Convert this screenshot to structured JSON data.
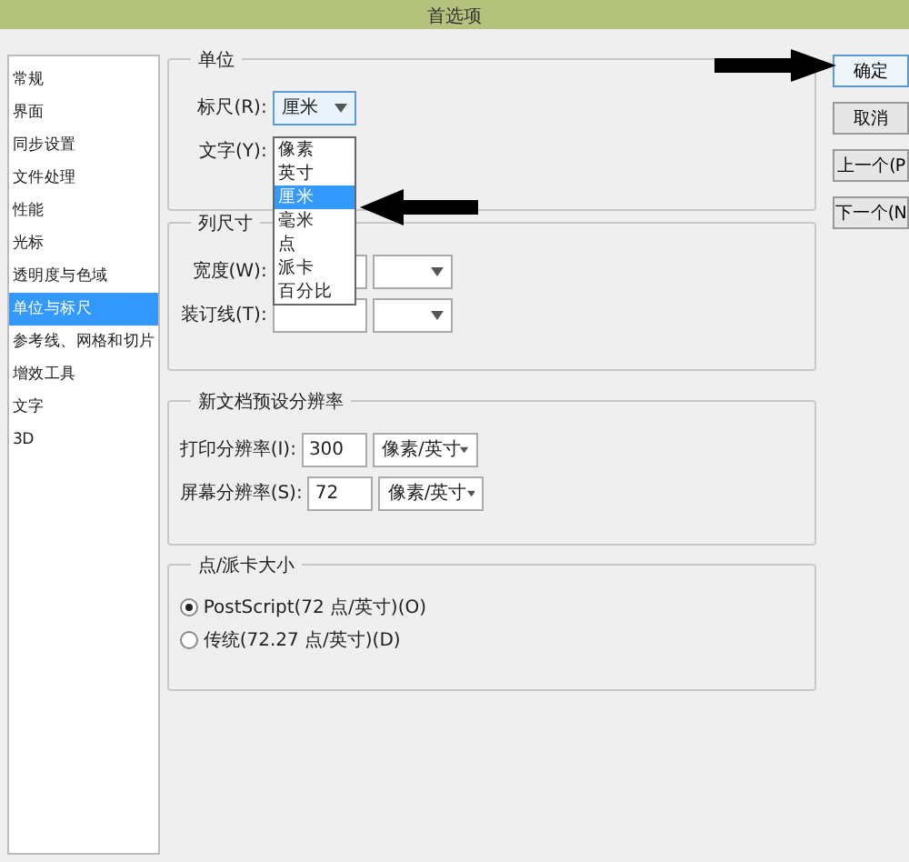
{
  "window": {
    "title": "首选项"
  },
  "sidebar": {
    "items": [
      {
        "label": "常规",
        "selected": false
      },
      {
        "label": "界面",
        "selected": false
      },
      {
        "label": "同步设置",
        "selected": false
      },
      {
        "label": "文件处理",
        "selected": false
      },
      {
        "label": "性能",
        "selected": false
      },
      {
        "label": "光标",
        "selected": false
      },
      {
        "label": "透明度与色域",
        "selected": false
      },
      {
        "label": "单位与标尺",
        "selected": true
      },
      {
        "label": "参考线、网格和切片",
        "selected": false
      },
      {
        "label": "增效工具",
        "selected": false
      },
      {
        "label": "文字",
        "selected": false
      },
      {
        "label": "3D",
        "selected": false
      }
    ]
  },
  "units": {
    "title": "单位",
    "fields": [
      {
        "label": "标尺(R):",
        "value": "厘米",
        "expanded": true
      },
      {
        "label": "文字(Y):"
      }
    ],
    "ruler_menu": [
      {
        "label": "像素",
        "selected": false
      },
      {
        "label": "英寸",
        "selected": false
      },
      {
        "label": "厘米",
        "selected": true
      },
      {
        "label": "毫米",
        "selected": false
      },
      {
        "label": "点",
        "selected": false
      },
      {
        "label": "派卡",
        "selected": false
      },
      {
        "label": "百分比",
        "selected": false
      }
    ]
  },
  "column_size": {
    "title": "列尺寸",
    "fields": [
      {
        "label": "宽度(W):"
      },
      {
        "label": "装订线(T):"
      }
    ]
  },
  "resolution": {
    "title": "新文档预设分辨率",
    "fields": [
      {
        "label": "打印分辨率(I):",
        "value": "300",
        "unit": "像素/英寸"
      },
      {
        "label": "屏幕分辨率(S):",
        "value": "72",
        "unit": "像素/英寸"
      }
    ]
  },
  "point_size": {
    "title": "点/派卡大小",
    "options": [
      {
        "label": "PostScript(72 点/英寸)(O)",
        "selected": true
      },
      {
        "label": "传统(72.27 点/英寸)(D)",
        "selected": false
      }
    ]
  },
  "buttons": [
    {
      "label": "确定",
      "kind": "default"
    },
    {
      "label": "取消",
      "kind": "normal"
    },
    {
      "label": "上一个(P",
      "kind": "normal"
    },
    {
      "label": "下一个(N",
      "kind": "normal"
    }
  ]
}
